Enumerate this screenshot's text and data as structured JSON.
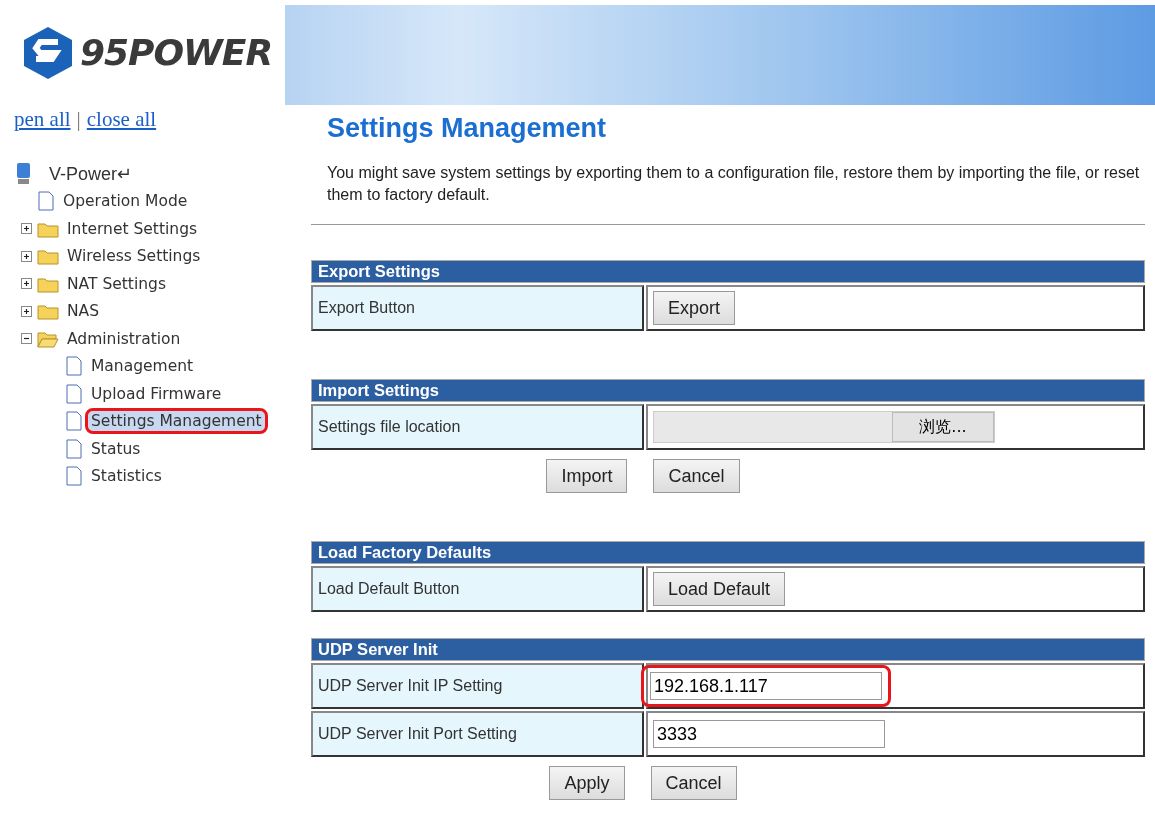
{
  "logo": {
    "text": "95POWER"
  },
  "tree_links": [
    {
      "label": "pen all"
    },
    {
      "label": "close all"
    }
  ],
  "tree_links_separator": "|",
  "tree": {
    "label": "V-Power↵",
    "children": [
      {
        "label": "Operation Mode",
        "kind": "page",
        "selected": false
      },
      {
        "label": "Internet Settings",
        "kind": "folder",
        "expanded": false,
        "selected": false
      },
      {
        "label": "Wireless Settings",
        "kind": "folder",
        "expanded": false,
        "selected": false
      },
      {
        "label": "NAT Settings",
        "kind": "folder",
        "expanded": false,
        "selected": false
      },
      {
        "label": "NAS",
        "kind": "folder",
        "expanded": false,
        "selected": false
      },
      {
        "label": "Administration",
        "kind": "folder",
        "expanded": true,
        "selected": false,
        "children": [
          {
            "label": "Management",
            "kind": "page",
            "selected": false
          },
          {
            "label": "Upload Firmware",
            "kind": "page",
            "selected": false
          },
          {
            "label": "Settings Management",
            "kind": "page",
            "selected": true,
            "highlighted": true
          },
          {
            "label": "Status",
            "kind": "page",
            "selected": false
          },
          {
            "label": "Statistics",
            "kind": "page",
            "selected": false
          }
        ]
      }
    ]
  },
  "page": {
    "title": "Settings Management",
    "description": "You might save system settings by exporting them to a configuration file, restore them by importing the file, or reset them to factory default."
  },
  "sections": [
    {
      "title": "Export Settings",
      "rows": [
        {
          "label": "Export Button",
          "kind": "button",
          "button": "Export"
        }
      ]
    },
    {
      "title": "Import Settings",
      "rows": [
        {
          "label": "Settings file location",
          "kind": "file",
          "button": "浏览..."
        }
      ],
      "buttons": [
        "Import",
        "Cancel"
      ]
    },
    {
      "title": "Load Factory Defaults",
      "rows": [
        {
          "label": "Load Default Button",
          "kind": "button",
          "button": "Load Default"
        }
      ]
    },
    {
      "title": "UDP Server Init",
      "rows": [
        {
          "label": "UDP Server Init IP Setting",
          "kind": "input",
          "value": "192.168.1.117",
          "highlighted": true
        },
        {
          "label": "UDP Server Init Port Setting",
          "kind": "input",
          "value": "3333",
          "highlighted": false
        }
      ],
      "buttons": [
        "Apply",
        "Cancel"
      ]
    }
  ]
}
